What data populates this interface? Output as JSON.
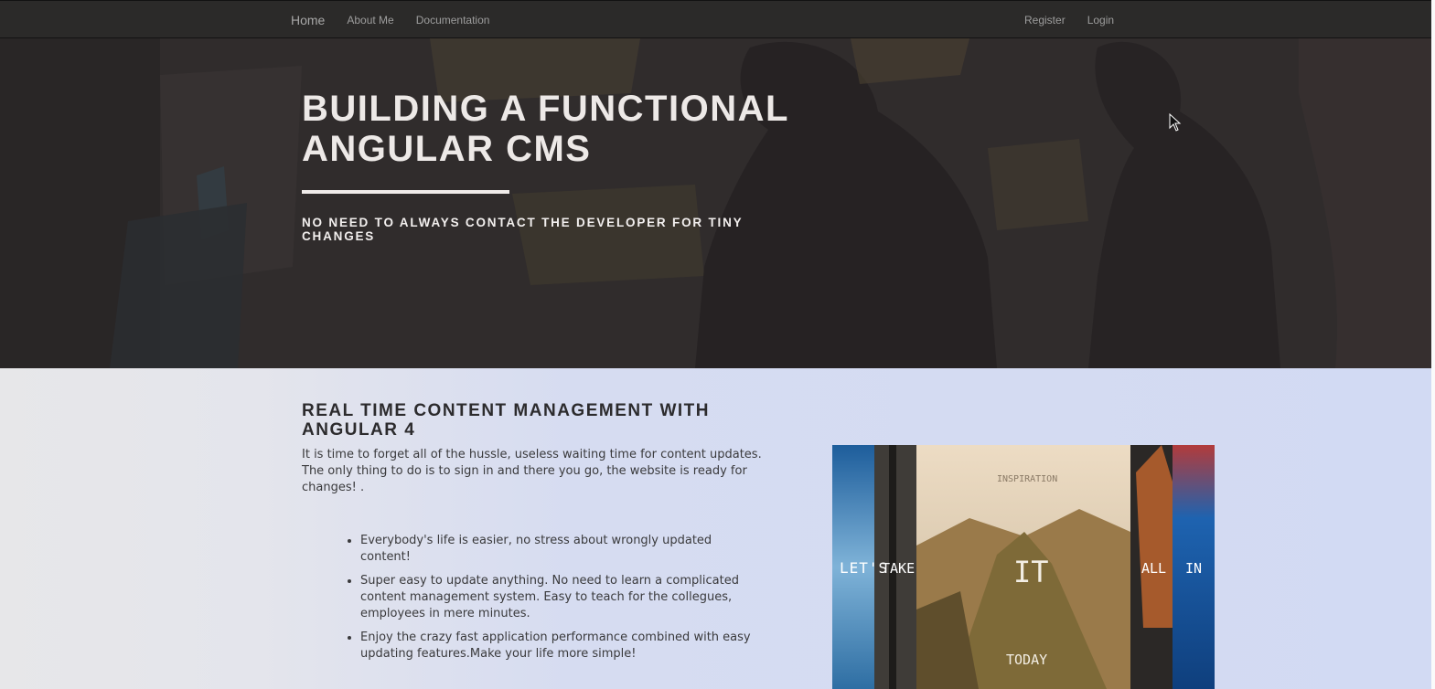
{
  "navbar": {
    "brand": "Home",
    "left_links": [
      "About Me",
      "Documentation"
    ],
    "right_links": [
      "Register",
      "Login"
    ]
  },
  "hero": {
    "title": "BUILDING A FUNCTIONAL ANGULAR CMS",
    "subtitle": "NO NEED TO ALWAYS CONTACT THE DEVELOPER FOR TINY CHANGES"
  },
  "section": {
    "title": "REAL TIME CONTENT MANAGEMENT WITH ANGULAR 4",
    "intro": "It is time to forget all of the hussle, useless waiting time for content updates. The only thing to do is to sign in and there you go, the website is ready for changes! .",
    "features": [
      "Everybody's life is easier, no stress about wrongly updated content!",
      "Super easy to update anything. No need to learn a complicated content management system. Easy to teach for the collegues, employees in mere minutes.",
      "Enjoy the crazy fast application performance combined with easy updating features.Make your life more simple!"
    ]
  },
  "promo_image": {
    "words": [
      "LET'S",
      "TAKE",
      "INSPIRATION",
      "IT",
      "TODAY",
      "ALL",
      "IN"
    ]
  },
  "colors": {
    "navbar_bg": "#2b2a29",
    "hero_overlay": "#2f2b2c",
    "content_bg": "#d2daf3",
    "text_dark": "#2c2b2d"
  },
  "icons": [
    "mouse-cursor-icon"
  ]
}
